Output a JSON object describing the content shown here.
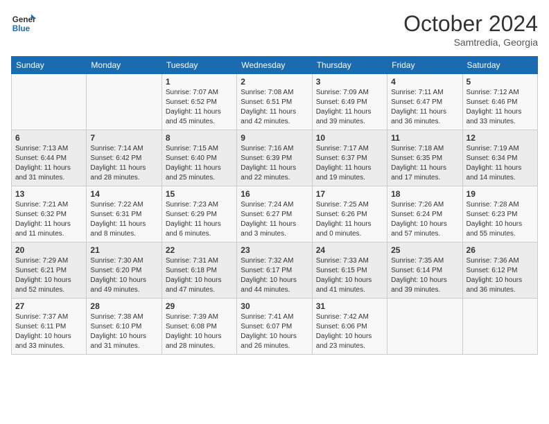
{
  "header": {
    "logo_line1": "General",
    "logo_line2": "Blue",
    "month": "October 2024",
    "location": "Samtredia, Georgia"
  },
  "days_of_week": [
    "Sunday",
    "Monday",
    "Tuesday",
    "Wednesday",
    "Thursday",
    "Friday",
    "Saturday"
  ],
  "weeks": [
    [
      {
        "day": null
      },
      {
        "day": null
      },
      {
        "day": "1",
        "sunrise": "Sunrise: 7:07 AM",
        "sunset": "Sunset: 6:52 PM",
        "daylight": "Daylight: 11 hours and 45 minutes."
      },
      {
        "day": "2",
        "sunrise": "Sunrise: 7:08 AM",
        "sunset": "Sunset: 6:51 PM",
        "daylight": "Daylight: 11 hours and 42 minutes."
      },
      {
        "day": "3",
        "sunrise": "Sunrise: 7:09 AM",
        "sunset": "Sunset: 6:49 PM",
        "daylight": "Daylight: 11 hours and 39 minutes."
      },
      {
        "day": "4",
        "sunrise": "Sunrise: 7:11 AM",
        "sunset": "Sunset: 6:47 PM",
        "daylight": "Daylight: 11 hours and 36 minutes."
      },
      {
        "day": "5",
        "sunrise": "Sunrise: 7:12 AM",
        "sunset": "Sunset: 6:46 PM",
        "daylight": "Daylight: 11 hours and 33 minutes."
      }
    ],
    [
      {
        "day": "6",
        "sunrise": "Sunrise: 7:13 AM",
        "sunset": "Sunset: 6:44 PM",
        "daylight": "Daylight: 11 hours and 31 minutes."
      },
      {
        "day": "7",
        "sunrise": "Sunrise: 7:14 AM",
        "sunset": "Sunset: 6:42 PM",
        "daylight": "Daylight: 11 hours and 28 minutes."
      },
      {
        "day": "8",
        "sunrise": "Sunrise: 7:15 AM",
        "sunset": "Sunset: 6:40 PM",
        "daylight": "Daylight: 11 hours and 25 minutes."
      },
      {
        "day": "9",
        "sunrise": "Sunrise: 7:16 AM",
        "sunset": "Sunset: 6:39 PM",
        "daylight": "Daylight: 11 hours and 22 minutes."
      },
      {
        "day": "10",
        "sunrise": "Sunrise: 7:17 AM",
        "sunset": "Sunset: 6:37 PM",
        "daylight": "Daylight: 11 hours and 19 minutes."
      },
      {
        "day": "11",
        "sunrise": "Sunrise: 7:18 AM",
        "sunset": "Sunset: 6:35 PM",
        "daylight": "Daylight: 11 hours and 17 minutes."
      },
      {
        "day": "12",
        "sunrise": "Sunrise: 7:19 AM",
        "sunset": "Sunset: 6:34 PM",
        "daylight": "Daylight: 11 hours and 14 minutes."
      }
    ],
    [
      {
        "day": "13",
        "sunrise": "Sunrise: 7:21 AM",
        "sunset": "Sunset: 6:32 PM",
        "daylight": "Daylight: 11 hours and 11 minutes."
      },
      {
        "day": "14",
        "sunrise": "Sunrise: 7:22 AM",
        "sunset": "Sunset: 6:31 PM",
        "daylight": "Daylight: 11 hours and 8 minutes."
      },
      {
        "day": "15",
        "sunrise": "Sunrise: 7:23 AM",
        "sunset": "Sunset: 6:29 PM",
        "daylight": "Daylight: 11 hours and 6 minutes."
      },
      {
        "day": "16",
        "sunrise": "Sunrise: 7:24 AM",
        "sunset": "Sunset: 6:27 PM",
        "daylight": "Daylight: 11 hours and 3 minutes."
      },
      {
        "day": "17",
        "sunrise": "Sunrise: 7:25 AM",
        "sunset": "Sunset: 6:26 PM",
        "daylight": "Daylight: 11 hours and 0 minutes."
      },
      {
        "day": "18",
        "sunrise": "Sunrise: 7:26 AM",
        "sunset": "Sunset: 6:24 PM",
        "daylight": "Daylight: 10 hours and 57 minutes."
      },
      {
        "day": "19",
        "sunrise": "Sunrise: 7:28 AM",
        "sunset": "Sunset: 6:23 PM",
        "daylight": "Daylight: 10 hours and 55 minutes."
      }
    ],
    [
      {
        "day": "20",
        "sunrise": "Sunrise: 7:29 AM",
        "sunset": "Sunset: 6:21 PM",
        "daylight": "Daylight: 10 hours and 52 minutes."
      },
      {
        "day": "21",
        "sunrise": "Sunrise: 7:30 AM",
        "sunset": "Sunset: 6:20 PM",
        "daylight": "Daylight: 10 hours and 49 minutes."
      },
      {
        "day": "22",
        "sunrise": "Sunrise: 7:31 AM",
        "sunset": "Sunset: 6:18 PM",
        "daylight": "Daylight: 10 hours and 47 minutes."
      },
      {
        "day": "23",
        "sunrise": "Sunrise: 7:32 AM",
        "sunset": "Sunset: 6:17 PM",
        "daylight": "Daylight: 10 hours and 44 minutes."
      },
      {
        "day": "24",
        "sunrise": "Sunrise: 7:33 AM",
        "sunset": "Sunset: 6:15 PM",
        "daylight": "Daylight: 10 hours and 41 minutes."
      },
      {
        "day": "25",
        "sunrise": "Sunrise: 7:35 AM",
        "sunset": "Sunset: 6:14 PM",
        "daylight": "Daylight: 10 hours and 39 minutes."
      },
      {
        "day": "26",
        "sunrise": "Sunrise: 7:36 AM",
        "sunset": "Sunset: 6:12 PM",
        "daylight": "Daylight: 10 hours and 36 minutes."
      }
    ],
    [
      {
        "day": "27",
        "sunrise": "Sunrise: 7:37 AM",
        "sunset": "Sunset: 6:11 PM",
        "daylight": "Daylight: 10 hours and 33 minutes."
      },
      {
        "day": "28",
        "sunrise": "Sunrise: 7:38 AM",
        "sunset": "Sunset: 6:10 PM",
        "daylight": "Daylight: 10 hours and 31 minutes."
      },
      {
        "day": "29",
        "sunrise": "Sunrise: 7:39 AM",
        "sunset": "Sunset: 6:08 PM",
        "daylight": "Daylight: 10 hours and 28 minutes."
      },
      {
        "day": "30",
        "sunrise": "Sunrise: 7:41 AM",
        "sunset": "Sunset: 6:07 PM",
        "daylight": "Daylight: 10 hours and 26 minutes."
      },
      {
        "day": "31",
        "sunrise": "Sunrise: 7:42 AM",
        "sunset": "Sunset: 6:06 PM",
        "daylight": "Daylight: 10 hours and 23 minutes."
      },
      {
        "day": null
      },
      {
        "day": null
      }
    ]
  ]
}
